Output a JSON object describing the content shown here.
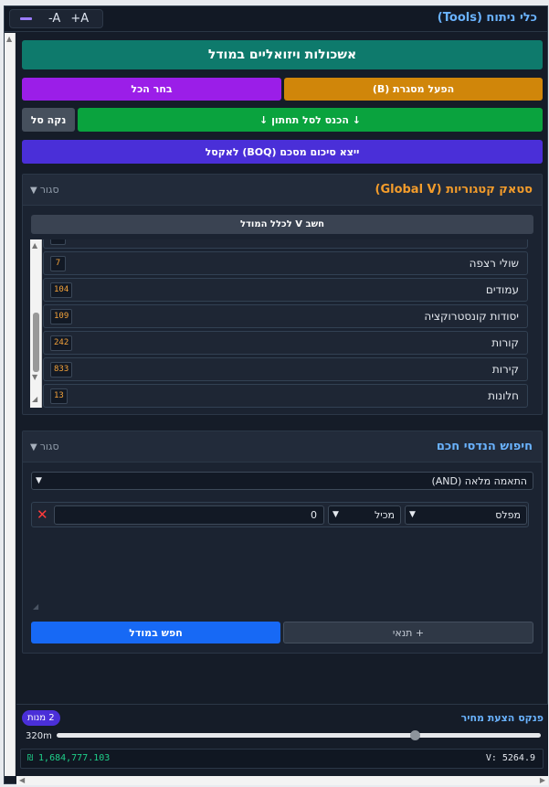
{
  "header": {
    "title": "כלי ניתוח (Tools)",
    "zoom_out": "-A",
    "zoom_in": "+A"
  },
  "buttons": {
    "visual_clusters": "אשכולות ויזואליים במודל",
    "activate_frame": "הפעל מסגרת (B)",
    "select_all": "בחר הכל",
    "clear_basket": "נקה סל",
    "enter_lower_basket": "↓ הכנס לסל תחתון ↓",
    "export_boq": "ייצא סיכום מסכם (BOQ) לאקסל"
  },
  "category_stack": {
    "title": "סטאק קטגוריות (Global V)",
    "toggle": "סגור",
    "calc_button": "חשב V לכלל המודל",
    "rows": [
      {
        "label": "שולי רצפה",
        "count": "7"
      },
      {
        "label": "עמודים",
        "count": "104"
      },
      {
        "label": "יסודות קונסטרוקציה",
        "count": "109"
      },
      {
        "label": "קורות",
        "count": "242"
      },
      {
        "label": "קירות",
        "count": "833"
      },
      {
        "label": "חלונות",
        "count": "13"
      }
    ]
  },
  "smart_search": {
    "title": "חיפוש הנדסי חכם",
    "toggle": "סגור",
    "match_mode": "התאמה מלאה (AND)",
    "condition": {
      "field": "מפלס",
      "operator": "מכיל",
      "value": "0"
    },
    "add_condition": "+ תנאי",
    "search_button": "חפש במודל"
  },
  "footer": {
    "title": "פנקס הצעת מחיר",
    "badge": "2 מנות",
    "slider_label": "320m",
    "slider_value": 0.74,
    "total": "₪ 1,684,777.103",
    "volume": "V: 5264.9"
  },
  "colors": {
    "teal": "#0e7a6c",
    "orange": "#d0860a",
    "purple": "#9b1ee8",
    "green": "#0aa33e",
    "indigo": "#4a2fd8",
    "blue": "#1769f5",
    "accent_blue": "#6ab3ff",
    "accent_orange": "#f39c2b"
  }
}
